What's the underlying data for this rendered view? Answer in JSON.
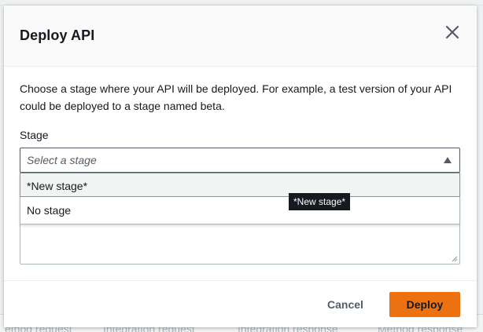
{
  "background": {
    "tabs": [
      "ethod request",
      "Integration request",
      "Integration response",
      "Method response"
    ]
  },
  "modal": {
    "title": "Deploy API",
    "description": "Choose a stage where your API will be deployed. For example, a test version of your API could be deployed to a stage named beta.",
    "stage": {
      "label": "Stage",
      "placeholder": "Select a stage",
      "options": [
        "*New stage*",
        "No stage"
      ],
      "highlighted_index": 0
    },
    "tooltip": "*New stage*",
    "footer": {
      "cancel_label": "Cancel",
      "deploy_label": "Deploy"
    },
    "colors": {
      "primary": "#ec7211",
      "text": "#16191f",
      "muted": "#545b64",
      "header_bg": "#fafafa"
    }
  }
}
